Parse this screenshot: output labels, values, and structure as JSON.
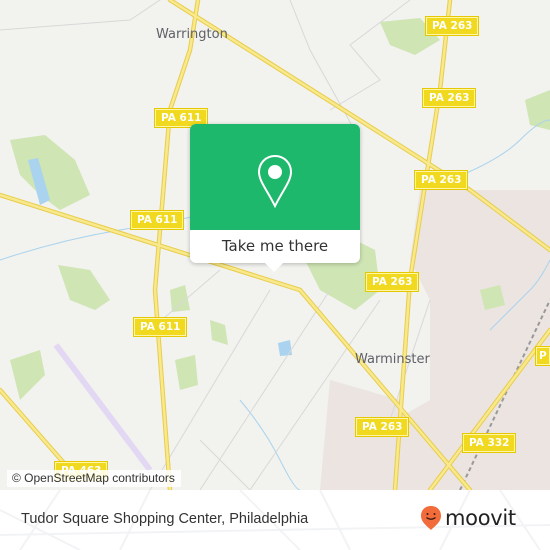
{
  "map": {
    "places": [
      {
        "name": "Warrington"
      },
      {
        "name": "Warminster"
      }
    ],
    "road_shields": [
      "PA 263",
      "PA 263",
      "PA 263",
      "PA 611",
      "PA 611",
      "PA 611",
      "PA 263",
      "PA 263",
      "PA 332",
      "PA 463"
    ],
    "attribution": "© OpenStreetMap contributors",
    "colors": {
      "background": "#f2f2ee",
      "major_road": "#f5e17a",
      "park": "#cfe5b4",
      "water": "#a9d3ee",
      "urban": "#ebe4e0"
    }
  },
  "popup": {
    "button_label": "Take me there",
    "icon": "map-pin-icon",
    "color": "#1eb86c"
  },
  "footer": {
    "title": "Tudor Square Shopping Center, Philadelphia",
    "brand": "moovit",
    "brand_color": "#f26b3a"
  }
}
